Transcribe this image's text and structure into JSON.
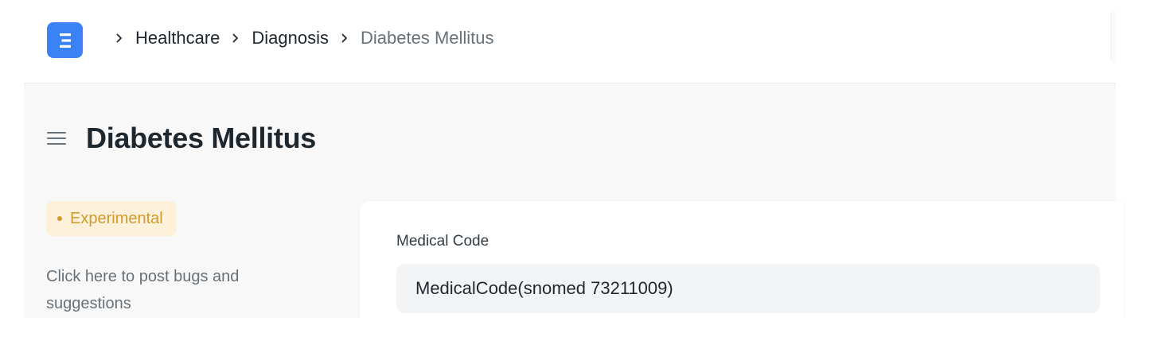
{
  "navbar": {
    "logo_letter": "E",
    "logo_color": "#3b82f6",
    "breadcrumb": [
      {
        "label": "Healthcare"
      },
      {
        "label": "Diagnosis"
      },
      {
        "label": "Diabetes Mellitus"
      }
    ],
    "separator_icon": "chevron-right-icon"
  },
  "page": {
    "title": "Diabetes Mellitus",
    "menu_icon": "hamburger-menu-icon"
  },
  "sidebar": {
    "badge_label": "Experimental",
    "badge_color": "#d19a2e",
    "feedback_text": "Click here to post bugs and suggestions"
  },
  "form": {
    "medical_code": {
      "label": "Medical Code",
      "value": "MedicalCode(snomed 73211009)"
    }
  }
}
